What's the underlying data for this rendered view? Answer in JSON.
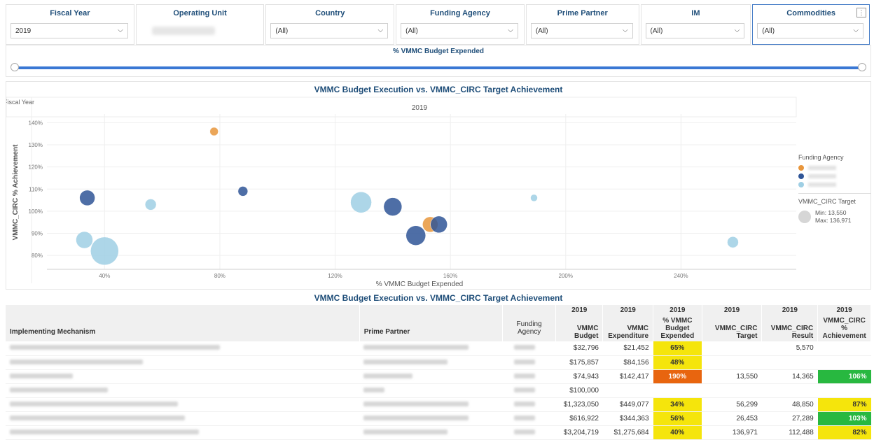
{
  "filters": [
    {
      "label": "Fiscal Year",
      "value": "2019"
    },
    {
      "label": "Operating Unit",
      "value": ""
    },
    {
      "label": "Country",
      "value": "(All)"
    },
    {
      "label": "Funding Agency",
      "value": "(All)"
    },
    {
      "label": "Prime Partner",
      "value": "(All)"
    },
    {
      "label": "IM",
      "value": "(All)"
    },
    {
      "label": "Commodities",
      "value": "(All)"
    }
  ],
  "slider": {
    "title": "% VMMC Budget Expended"
  },
  "chart_data": {
    "type": "scatter",
    "title": "VMMC Budget Execution vs. VMMC_CIRC Target Achievement",
    "xlabel": "% VMMC Budget Expended",
    "ylabel": "VMMC_CIRC % Achievement",
    "fiscal_year_label": "Fiscal Year",
    "fiscal_year_value": "2019",
    "xlim": [
      20,
      280
    ],
    "ylim": [
      75,
      142
    ],
    "x_ticks": [
      "40%",
      "80%",
      "120%",
      "160%",
      "200%",
      "240%"
    ],
    "y_ticks": [
      "80%",
      "90%",
      "100%",
      "110%",
      "120%",
      "130%",
      "140%"
    ],
    "points": [
      {
        "x": 78,
        "y": 136,
        "size": 6,
        "color": "#e8963c"
      },
      {
        "x": 34,
        "y": 106,
        "size": 11,
        "color": "#2f5597"
      },
      {
        "x": 56,
        "y": 103,
        "size": 8,
        "color": "#9fcfe4"
      },
      {
        "x": 88,
        "y": 109,
        "size": 7,
        "color": "#2f5597"
      },
      {
        "x": 33,
        "y": 87,
        "size": 12,
        "color": "#9fcfe4"
      },
      {
        "x": 40,
        "y": 82,
        "size": 20,
        "color": "#9fcfe4"
      },
      {
        "x": 129,
        "y": 104,
        "size": 15,
        "color": "#9fcfe4"
      },
      {
        "x": 140,
        "y": 102,
        "size": 13,
        "color": "#2f5597"
      },
      {
        "x": 148,
        "y": 89,
        "size": 14,
        "color": "#2f5597"
      },
      {
        "x": 153,
        "y": 94,
        "size": 11,
        "color": "#e8963c"
      },
      {
        "x": 156,
        "y": 94,
        "size": 12,
        "color": "#2f5597"
      },
      {
        "x": 189,
        "y": 106,
        "size": 5,
        "color": "#9fcfe4"
      },
      {
        "x": 258,
        "y": 86,
        "size": 8,
        "color": "#9fcfe4"
      }
    ],
    "legend": {
      "agency_title": "Funding Agency",
      "agency_colors": [
        "#e8963c",
        "#2f5597",
        "#9fcfe4"
      ],
      "size_title": "VMMC_CIRC Target",
      "size_min": "Min: 13,550",
      "size_max": "Max: 136,971"
    }
  },
  "table": {
    "title": "VMMC Budget Execution vs. VMMC_CIRC Target Achievement",
    "year": "2019",
    "headers": [
      "Implementing Mechanism",
      "Prime Partner",
      "Funding Agency",
      "VMMC Budget",
      "VMMC Expenditure",
      "% VMMC Budget Expended",
      "VMMC_CIRC Target",
      "VMMC_CIRC Result",
      "VMMC_CIRC % Achievement"
    ],
    "rows": [
      {
        "budget": "$32,796",
        "expenditure": "$21,452",
        "pct": "65%",
        "pct_color": "#f5e50c",
        "target": "",
        "result": "5,570",
        "ach": "",
        "ach_color": ""
      },
      {
        "budget": "$175,857",
        "expenditure": "$84,156",
        "pct": "48%",
        "pct_color": "#f5e50c",
        "target": "",
        "result": "",
        "ach": "",
        "ach_color": ""
      },
      {
        "budget": "$74,943",
        "expenditure": "$142,417",
        "pct": "190%",
        "pct_color": "#e8650f",
        "target": "13,550",
        "result": "14,365",
        "ach": "106%",
        "ach_color": "#28b840"
      },
      {
        "budget": "$100,000",
        "expenditure": "",
        "pct": "",
        "pct_color": "",
        "target": "",
        "result": "",
        "ach": "",
        "ach_color": ""
      },
      {
        "budget": "$1,323,050",
        "expenditure": "$449,077",
        "pct": "34%",
        "pct_color": "#f5e50c",
        "target": "56,299",
        "result": "48,850",
        "ach": "87%",
        "ach_color": "#f5e50c"
      },
      {
        "budget": "$616,922",
        "expenditure": "$344,363",
        "pct": "56%",
        "pct_color": "#f5e50c",
        "target": "26,453",
        "result": "27,289",
        "ach": "103%",
        "ach_color": "#28b840"
      },
      {
        "budget": "$3,204,719",
        "expenditure": "$1,275,684",
        "pct": "40%",
        "pct_color": "#f5e50c",
        "target": "136,971",
        "result": "112,488",
        "ach": "82%",
        "ach_color": "#f5e50c"
      }
    ]
  }
}
